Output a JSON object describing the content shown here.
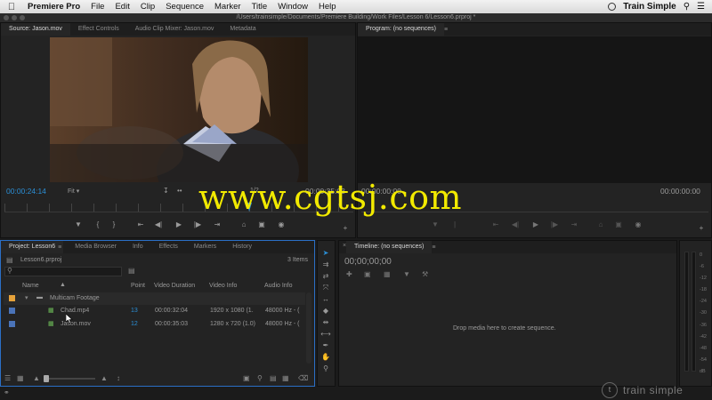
{
  "menubar": {
    "apple": "",
    "items": [
      "Premiere Pro",
      "File",
      "Edit",
      "Clip",
      "Sequence",
      "Marker",
      "Title",
      "Window",
      "Help"
    ],
    "right_label": "Train Simple"
  },
  "titlebar": {
    "path": "/Users/trainsimple/Documents/Premiere Building/Work Files/Lesson 6/Lesson6.prproj *"
  },
  "source": {
    "tabs": [
      "Source: Jason.mov",
      "Effect Controls",
      "Audio Clip Mixer: Jason.mov",
      "Metadata"
    ],
    "timecode_in": "00:00:24:14",
    "fit_label": "Fit",
    "zoom_fraction": "1/2",
    "timecode_dur": "00:00:35:03"
  },
  "program": {
    "tab": "Program: (no sequences)",
    "timecode_left": "00:00:00:00",
    "timecode_right": "00:00:00:00"
  },
  "watermark": "www.cgtsj.com",
  "project": {
    "tabs": [
      "Project: Lesson6",
      "Media Browser",
      "Info",
      "Effects",
      "Markers",
      "History"
    ],
    "file": "Lesson6.prproj",
    "items_count": "3 Items",
    "columns": {
      "name": "Name",
      "point": "Point",
      "video_duration": "Video Duration",
      "video_info": "Video Info",
      "audio_info": "Audio Info"
    },
    "rows": [
      {
        "name": "Multicam Footage",
        "point": "",
        "duration": "",
        "video_info": "",
        "audio_info": "",
        "color": "#e6a23a",
        "type": "folder"
      },
      {
        "name": "Chad.mp4",
        "point": "13",
        "duration": "00:00:32:04",
        "video_info": "1920 x 1080 (1.",
        "audio_info": "48000 Hz - (",
        "color": "#4a73b8",
        "type": "clip"
      },
      {
        "name": "Jason.mov",
        "point": "12",
        "duration": "00:00:35:03",
        "video_info": "1280 x 720 (1.0)",
        "audio_info": "48000 Hz - (",
        "color": "#4a73b8",
        "type": "clip"
      }
    ]
  },
  "timeline": {
    "tab": "Timeline: (no sequences)",
    "timecode": "00;00;00;00",
    "drop_message": "Drop media here to create sequence."
  },
  "meter": {
    "ticks": [
      "0",
      "-6",
      "-12",
      "-18",
      "-24",
      "-30",
      "-36",
      "-42",
      "-48",
      "-54",
      "dB"
    ]
  },
  "brand": "train simple",
  "colors": {
    "accent_blue": "#2b8fd6",
    "watermark_yellow": "#f2ea00",
    "folder": "#e6a23a",
    "clip": "#4a73b8"
  }
}
